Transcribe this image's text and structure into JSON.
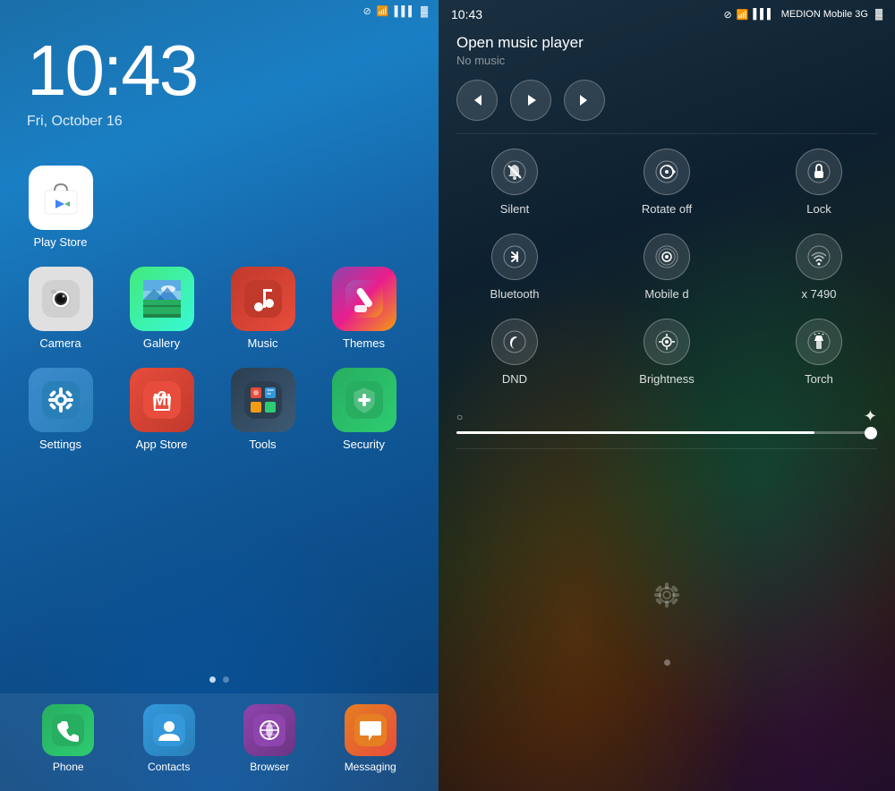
{
  "left": {
    "status": {
      "icons": "⊘ 📶 ▓ 🔋"
    },
    "clock": {
      "time": "10:43",
      "date": "Fri, October 16"
    },
    "apps": {
      "row0": [
        {
          "id": "play-store",
          "label": "Play Store",
          "icon": "playstore"
        }
      ],
      "row1": [
        {
          "id": "camera",
          "label": "Camera",
          "icon": "camera"
        },
        {
          "id": "gallery",
          "label": "Gallery",
          "icon": "gallery"
        },
        {
          "id": "music",
          "label": "Music",
          "icon": "music"
        },
        {
          "id": "themes",
          "label": "Themes",
          "icon": "themes"
        }
      ],
      "row2": [
        {
          "id": "settings",
          "label": "Settings",
          "icon": "settings"
        },
        {
          "id": "app-store",
          "label": "App Store",
          "icon": "appstore"
        },
        {
          "id": "tools",
          "label": "Tools",
          "icon": "tools"
        },
        {
          "id": "security",
          "label": "Security",
          "icon": "security"
        }
      ]
    },
    "page_dots": [
      true,
      false
    ],
    "bottom_apps": [
      {
        "id": "phone",
        "label": "Phone",
        "icon": "phone"
      },
      {
        "id": "contacts",
        "label": "Contacts",
        "icon": "contacts"
      },
      {
        "id": "browser",
        "label": "Browser",
        "icon": "browser"
      },
      {
        "id": "messaging",
        "label": "Messaging",
        "icon": "messaging"
      }
    ]
  },
  "right": {
    "status": {
      "time": "10:43",
      "carrier": "MEDION Mobile 3G",
      "icons": "⊘ 📶 ▓ 🔋"
    },
    "music": {
      "title": "Open music player",
      "subtitle": "No music",
      "prev_label": "prev",
      "play_label": "play",
      "next_label": "next"
    },
    "toggles": {
      "row1": [
        {
          "id": "silent",
          "label": "Silent",
          "icon": "🔕"
        },
        {
          "id": "rotate-off",
          "label": "Rotate off",
          "icon": "🔒"
        },
        {
          "id": "lock",
          "label": "Lock",
          "icon": "🔒"
        }
      ],
      "row2": [
        {
          "id": "bluetooth",
          "label": "Bluetooth",
          "icon": "✶"
        },
        {
          "id": "mobile-data",
          "label": "Mobile d",
          "icon": "⊙"
        },
        {
          "id": "wifi-7490",
          "label": "x 7490",
          "icon": "📶"
        }
      ],
      "row3": [
        {
          "id": "dnd",
          "label": "DND",
          "icon": "☽"
        },
        {
          "id": "brightness",
          "label": "Brightness",
          "icon": "⊙"
        },
        {
          "id": "torch",
          "label": "Torch",
          "icon": "🔦"
        }
      ]
    },
    "brightness_value": 85
  }
}
